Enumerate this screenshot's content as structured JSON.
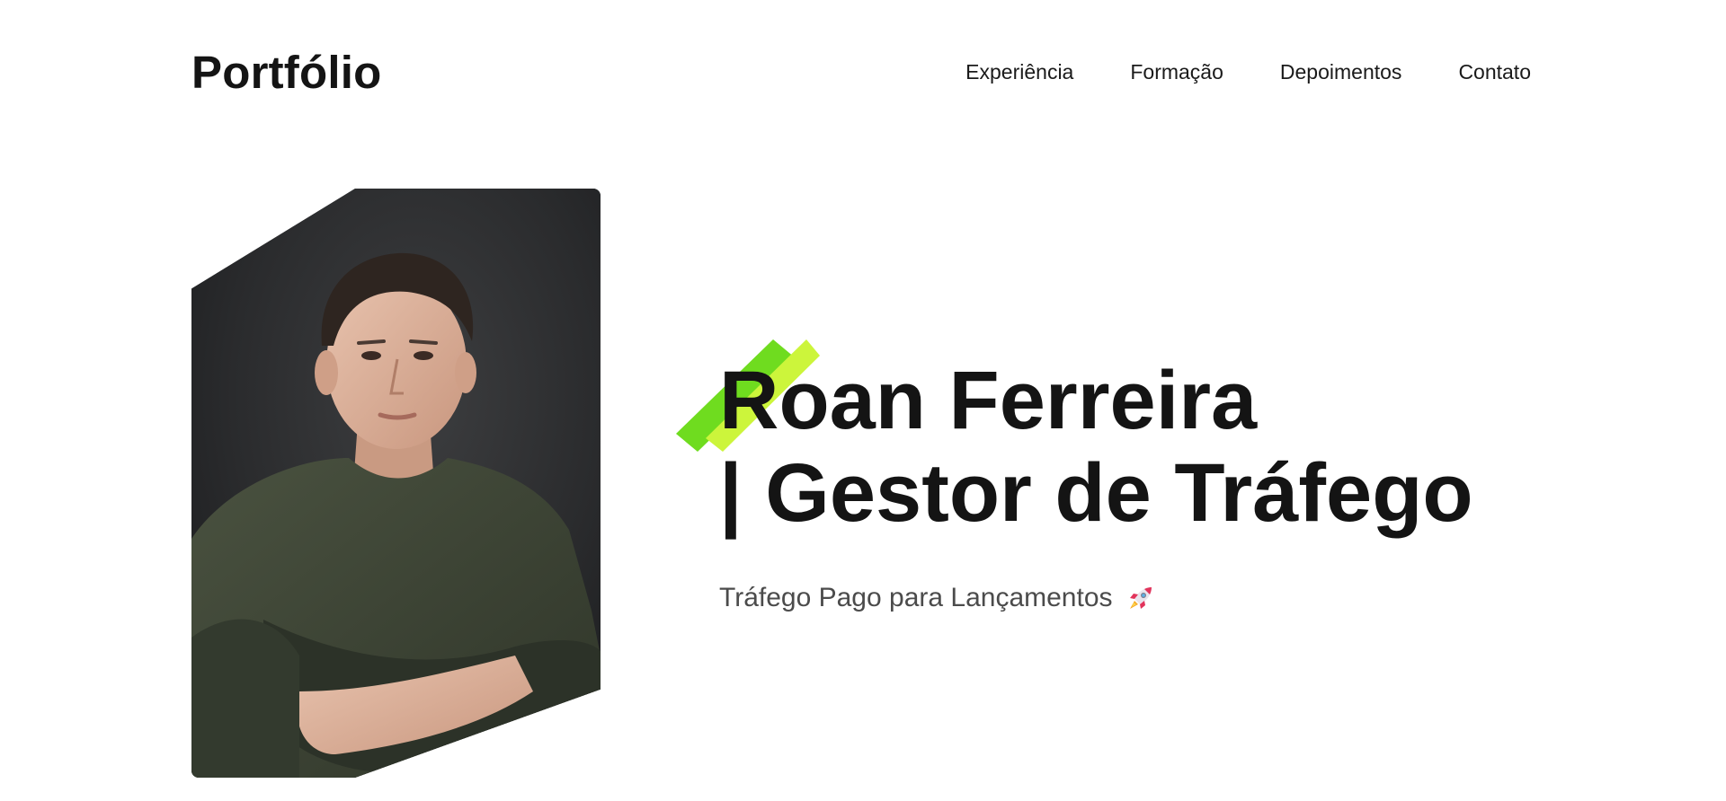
{
  "header": {
    "brand": "Portfólio",
    "nav": [
      {
        "label": "Experiência"
      },
      {
        "label": "Formação"
      },
      {
        "label": "Depoimentos"
      },
      {
        "label": "Contato"
      }
    ]
  },
  "hero": {
    "title_line1": "Roan Ferreira",
    "title_line2": "| Gestor de Tráfego",
    "subtitle": "Tráfego Pago para Lançamentos",
    "subtitle_icon": "rocket-icon",
    "photo_alt": "portrait-photo",
    "accent_colors": [
      "#6fdc1f",
      "#ccf53b"
    ]
  }
}
